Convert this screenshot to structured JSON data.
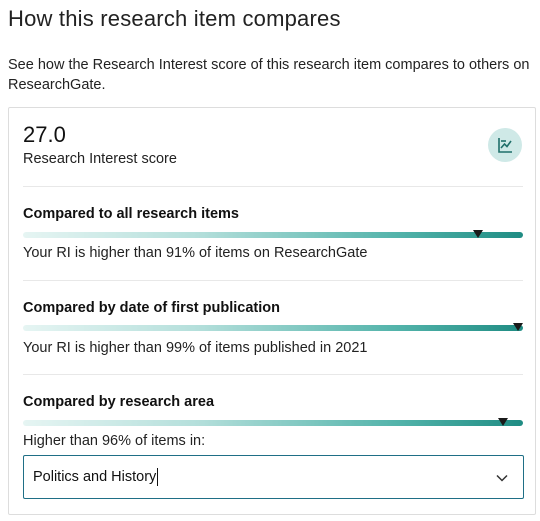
{
  "header": {
    "title": "How this research item compares",
    "description": "See how the Research Interest score of this research item compares to others on ResearchGate."
  },
  "score": {
    "value": "27.0",
    "label": "Research Interest score",
    "chart_icon": "chart-icon"
  },
  "comparisons": [
    {
      "heading": "Compared to all research items",
      "text": "Your RI is higher than 91% of items on ResearchGate",
      "percentile": 91
    },
    {
      "heading": "Compared by date of first publication",
      "text": "Your RI is higher than 99% of items published in 2021",
      "percentile": 99
    },
    {
      "heading": "Compared by research area",
      "text": "Higher than 96% of items in:",
      "percentile": 96
    }
  ],
  "research_area_select": {
    "value": "Politics and History",
    "icon": "chevron-down-icon"
  },
  "colors": {
    "accent": "#1f8c83",
    "icon_bg": "#cfe9e7",
    "select_border": "#1f6f86"
  }
}
